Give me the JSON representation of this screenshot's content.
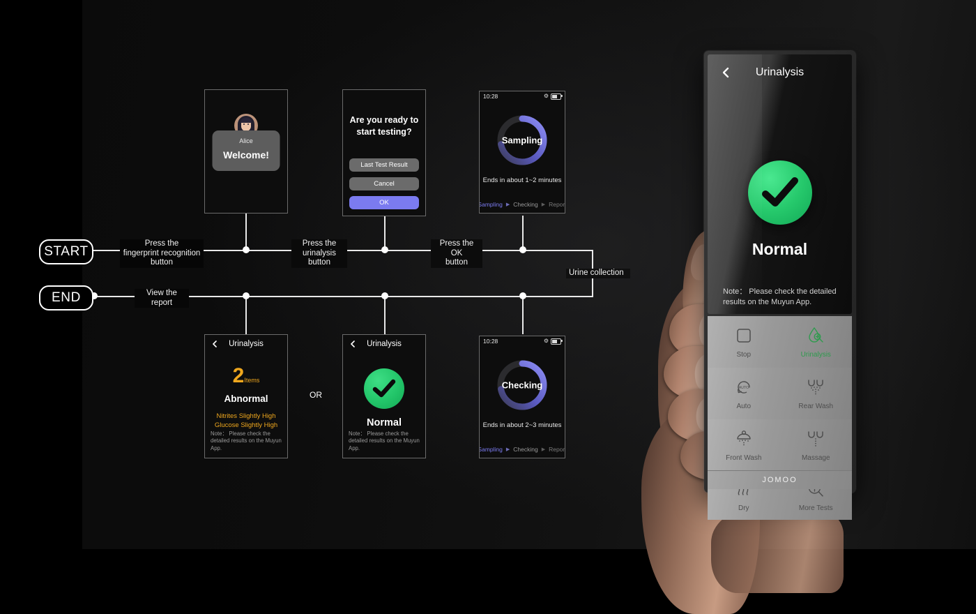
{
  "flow": {
    "start_label": "START",
    "end_label": "END",
    "edges": [
      {
        "id": "e1",
        "text": "Press the\nfingerprint recognition\nbutton"
      },
      {
        "id": "e2",
        "text": "Press the\nurinalysis\nbutton"
      },
      {
        "id": "e3",
        "text": "Press the\nOK\nbutton"
      },
      {
        "id": "e4",
        "text": "Urine collection"
      },
      {
        "id": "e5",
        "text": "View the\nreport"
      }
    ],
    "or_label": "OR"
  },
  "screens": {
    "welcome": {
      "user_name": "Alice",
      "message": "Welcome!"
    },
    "dialog": {
      "question": "Are you ready to\nstart testing?",
      "buttons": [
        {
          "label": "Last Test Result",
          "style": "grey"
        },
        {
          "label": "Cancel",
          "style": "grey"
        },
        {
          "label": "OK",
          "style": "accent"
        }
      ]
    },
    "sampling": {
      "status_time": "10:28",
      "ring_label": "Sampling",
      "eta": "Ends in about 1~2 minutes",
      "steps": [
        "Sampling",
        "Checking",
        "Report"
      ],
      "active_step": "Sampling",
      "progress_pct": 72
    },
    "checking": {
      "status_time": "10:28",
      "ring_label": "Checking",
      "eta": "Ends in about 2~3 minutes",
      "steps": [
        "Sampling",
        "Checking",
        "Report"
      ],
      "active_step": "Sampling",
      "progress_pct": 72
    },
    "abnormal": {
      "nav_title": "Urinalysis",
      "count": "2",
      "count_unit": "Items",
      "verdict": "Abnormal",
      "findings": "Nitrites Slightly High\nGlucose Slightly High",
      "note": "Note： Please check the detailed results on the Muyun App."
    },
    "normal": {
      "nav_title": "Urinalysis",
      "verdict": "Normal",
      "note": "Note： Please check the detailed results on the Muyun App."
    }
  },
  "device": {
    "screen": {
      "nav_title": "Urinalysis",
      "verdict": "Normal",
      "note": "Note： Please check the detailed results on the Muyun App."
    },
    "buttons": [
      {
        "label": "Stop",
        "icon": "stop-square-icon",
        "active": false
      },
      {
        "label": "Urinalysis",
        "icon": "urine-drop-magnifier-icon",
        "active": true
      },
      {
        "label": "Auto",
        "icon": "auto-loop-icon",
        "active": false
      },
      {
        "label": "Rear Wash",
        "icon": "rear-wash-icon",
        "active": false
      },
      {
        "label": "Front Wash",
        "icon": "front-wash-icon",
        "active": false
      },
      {
        "label": "Massage",
        "icon": "massage-icon",
        "active": false
      },
      {
        "label": "Dry",
        "icon": "dry-waves-icon",
        "active": false
      },
      {
        "label": "More Tests",
        "icon": "more-tests-plus-icon",
        "active": false
      }
    ],
    "brand": "JOMOO"
  },
  "colors": {
    "accent_purple": "#7b7bf0",
    "ok_green": "#22c569",
    "warn_orange": "#f0a81e",
    "active_green": "#2f9b4e"
  }
}
